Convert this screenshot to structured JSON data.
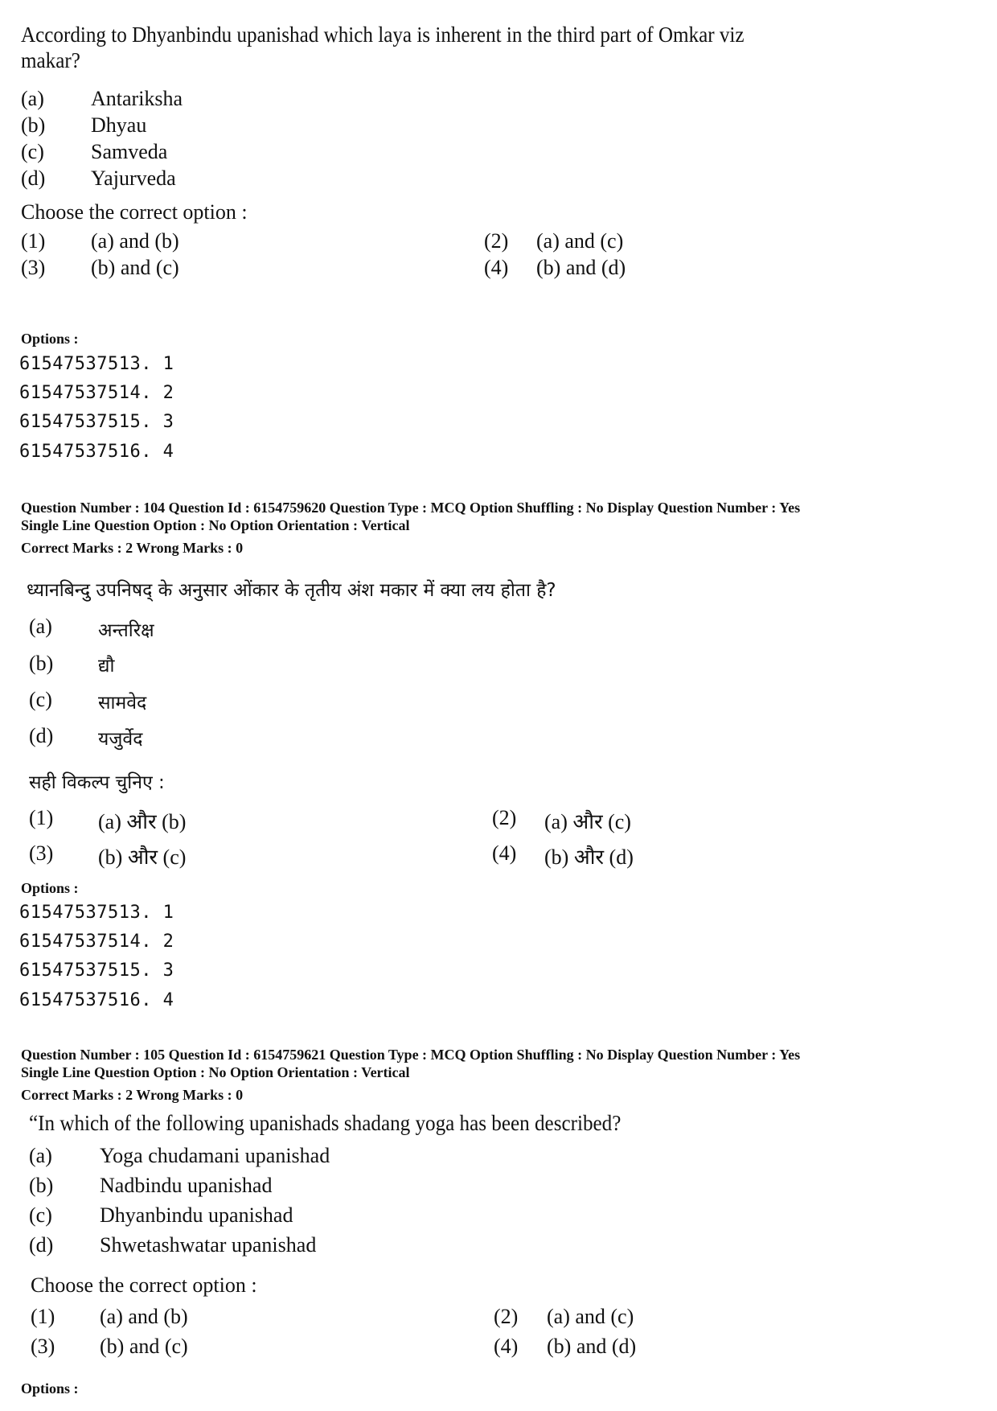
{
  "q103": {
    "question": "According to Dhyanbindu upanishad which laya is inherent in the third part of Omkar viz",
    "question_cont": "makar?",
    "items": [
      {
        "label": "(a)",
        "text": "Antariksha"
      },
      {
        "label": "(b)",
        "text": "Dhyau"
      },
      {
        "label": "(c)",
        "text": "Samveda"
      },
      {
        "label": "(d)",
        "text": "Yajurveda"
      }
    ],
    "choose": "Choose the correct option :",
    "answers": [
      {
        "label": "(1)",
        "text": "(a) and (b)"
      },
      {
        "label": "(2)",
        "text": "(a) and (c)"
      },
      {
        "label": "(3)",
        "text": "(b) and (c)"
      },
      {
        "label": "(4)",
        "text": "(b) and (d)"
      }
    ],
    "options_heading": "Options :",
    "option_codes": [
      "61547537513. 1",
      "61547537514. 2",
      "61547537515. 3",
      "61547537516. 4"
    ]
  },
  "q104": {
    "meta_line1": "Question Number : 104  Question Id : 6154759620  Question Type : MCQ  Option Shuffling : No  Display Question Number : Yes",
    "meta_line2": "Single Line Question Option : No  Option Orientation : Vertical",
    "marks": "Correct Marks : 2  Wrong Marks : 0",
    "question": "ध्यानबिन्दु उपनिषद् के अनुसार ओंकार के तृतीय अंश मकार में क्या लय होता है?",
    "items": [
      {
        "label": "(a)",
        "text": "अन्तरिक्ष"
      },
      {
        "label": "(b)",
        "text": "द्यौ"
      },
      {
        "label": "(c)",
        "text": "सामवेद"
      },
      {
        "label": "(d)",
        "text": "यजुर्वेद"
      }
    ],
    "choose": "सही विकल्प चुनिए :",
    "answers": [
      {
        "label": "(1)",
        "text": "(a) और (b)"
      },
      {
        "label": "(2)",
        "text": "(a) और (c)"
      },
      {
        "label": "(3)",
        "text": "(b) और (c)"
      },
      {
        "label": "(4)",
        "text": "(b) और (d)"
      }
    ],
    "options_heading": "Options :",
    "option_codes": [
      "61547537513. 1",
      "61547537514. 2",
      "61547537515. 3",
      "61547537516. 4"
    ]
  },
  "q105": {
    "meta_line1": "Question Number : 105  Question Id : 6154759621  Question Type : MCQ  Option Shuffling : No  Display Question Number : Yes",
    "meta_line2": "Single Line Question Option : No  Option Orientation : Vertical",
    "marks": "Correct Marks : 2  Wrong Marks : 0",
    "question": "“In which of the following upanishads shadang yoga has been described?",
    "items": [
      {
        "label": "(a)",
        "text": "Yoga chudamani upanishad"
      },
      {
        "label": "(b)",
        "text": "Nadbindu upanishad"
      },
      {
        "label": "(c)",
        "text": "Dhyanbindu upanishad"
      },
      {
        "label": "(d)",
        "text": "Shwetashwatar upanishad"
      }
    ],
    "choose": "Choose the correct option :",
    "answers": [
      {
        "label": "(1)",
        "text": "(a) and (b)"
      },
      {
        "label": "(2)",
        "text": "(a) and (c)"
      },
      {
        "label": "(3)",
        "text": "(b) and (c)"
      },
      {
        "label": "(4)",
        "text": "(b) and (d)"
      }
    ],
    "options_heading": "Options :"
  }
}
